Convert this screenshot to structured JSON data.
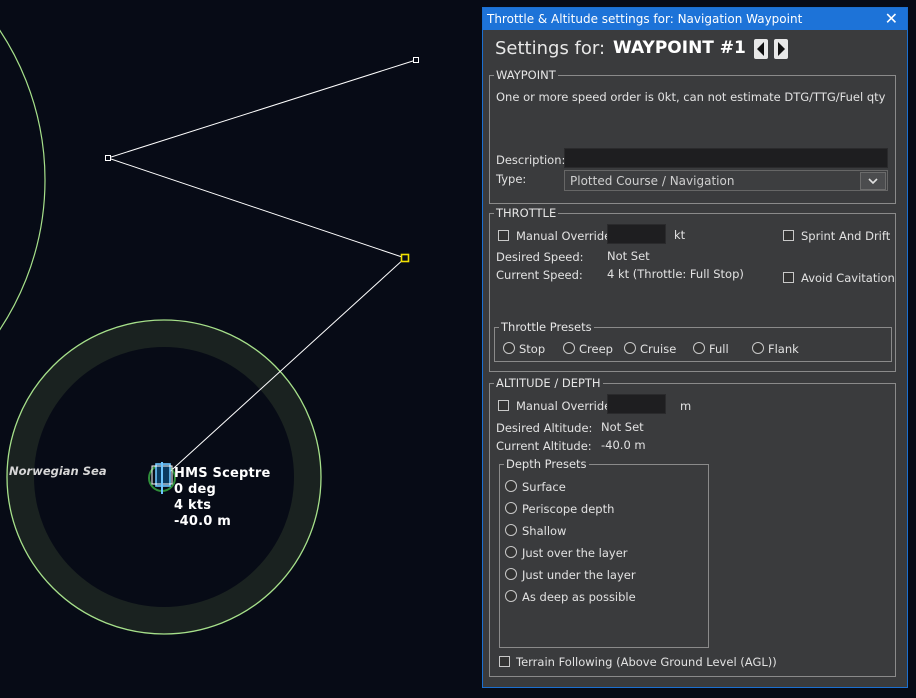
{
  "map": {
    "sea_label": "Norwegian Sea",
    "unit": {
      "name": "HMS Sceptre",
      "heading": "0 deg",
      "speed": "4 kts",
      "depth": "-40.0 m"
    },
    "colors": {
      "background": "#070b16",
      "range_ring": "#a6e08a",
      "course_line": "#ffffff",
      "selected_waypoint": "#f0e000",
      "unit_highlight": "#6ec6ff"
    }
  },
  "dialog": {
    "title": "Throttle & Altitude settings for: Navigation Waypoint",
    "close_icon": "close-icon",
    "settings_for_label": "Settings for:",
    "waypoint_name": "WAYPOINT #1",
    "waypoint_group": {
      "legend": "WAYPOINT",
      "message": "One or more speed order is 0kt, can not estimate DTG/TTG/Fuel qty",
      "description_label": "Description:",
      "description_value": "",
      "type_label": "Type:",
      "type_value": "Plotted Course / Navigation"
    },
    "throttle_group": {
      "legend": "THROTTLE",
      "manual_override_label": "Manual Override",
      "manual_override_checked": false,
      "speed_value": "",
      "speed_unit": "kt",
      "sprint_drift_label": "Sprint And Drift",
      "avoid_cavitation_label": "Avoid Cavitation",
      "desired_speed_label": "Desired Speed:",
      "desired_speed_value": "Not Set",
      "current_speed_label": "Current Speed:",
      "current_speed_value": "4 kt (Throttle: Full Stop)",
      "presets_legend": "Throttle Presets",
      "presets": [
        "Stop",
        "Creep",
        "Cruise",
        "Full",
        "Flank"
      ]
    },
    "altitude_group": {
      "legend": "ALTITUDE / DEPTH",
      "manual_override_label": "Manual Override",
      "altitude_value": "",
      "altitude_unit": "m",
      "desired_altitude_label": "Desired Altitude:",
      "desired_altitude_value": "Not Set",
      "current_altitude_label": "Current Altitude:",
      "current_altitude_value": "-40.0 m",
      "presets_legend": "Depth Presets",
      "presets": [
        "Surface",
        "Periscope depth",
        "Shallow",
        "Just over the layer",
        "Just under the layer",
        "As deep as possible"
      ],
      "terrain_following_label": "Terrain Following (Above Ground Level (AGL))"
    }
  }
}
